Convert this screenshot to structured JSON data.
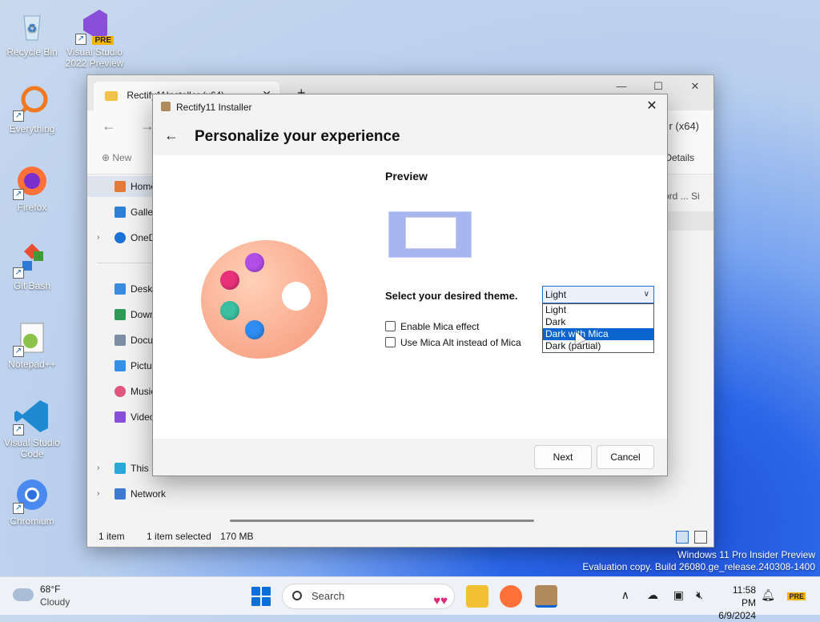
{
  "desktop": {
    "icons": [
      {
        "label": "Recycle Bin"
      },
      {
        "label": "Visual Studio 2022 Preview",
        "badge": "PRE"
      },
      {
        "label": "Everything"
      },
      {
        "label": "Firefox"
      },
      {
        "label": "Git Bash"
      },
      {
        "label": "Notepad++"
      },
      {
        "label": "Visual Studio Code"
      },
      {
        "label": "Chromium"
      }
    ]
  },
  "explorer": {
    "tab_title": "Rectify11Installer (x64)",
    "path_tail": "r (x64)",
    "new_label": "New",
    "details_label": "Details",
    "column_header": "ord ...   Si",
    "sidebar": [
      {
        "label": "Home"
      },
      {
        "label": "Gallery"
      },
      {
        "label": "OneDrive"
      },
      {
        "label": "Desktop"
      },
      {
        "label": "Downloads"
      },
      {
        "label": "Documents"
      },
      {
        "label": "Pictures"
      },
      {
        "label": "Music"
      },
      {
        "label": "Videos"
      },
      {
        "label": "This PC"
      },
      {
        "label": "Network"
      }
    ],
    "status": {
      "count": "1 item",
      "selected": "1 item selected",
      "size": "170 MB"
    }
  },
  "installer": {
    "window_title": "Rectify11 Installer",
    "heading": "Personalize your experience",
    "preview_label": "Preview",
    "theme_label": "Select your desired theme.",
    "selected_theme": "Light",
    "theme_options": [
      "Light",
      "Dark",
      "Dark with Mica",
      "Dark (partial)"
    ],
    "highlighted_option_index": 2,
    "checkboxes": [
      {
        "label": "Enable Mica effect",
        "checked": false
      },
      {
        "label": "Use Mica Alt instead of Mica",
        "checked": false
      }
    ],
    "next_label": "Next",
    "cancel_label": "Cancel"
  },
  "watermark": {
    "line1": "Windows 11 Pro Insider Preview",
    "line2": "Evaluation copy. Build 26080.ge_release.240308-1400"
  },
  "taskbar": {
    "weather_temp": "68°F",
    "weather_desc": "Cloudy",
    "search_placeholder": "Search",
    "time": "11:58 PM",
    "date": "6/9/2024",
    "copilot_badge": "PRE"
  },
  "colors": {
    "accent": "#0a64d0",
    "palette_pink": "#e8317a",
    "palette_purple": "#b14ee8",
    "palette_teal": "#3bbfa0",
    "palette_blue": "#2f8cf0"
  }
}
